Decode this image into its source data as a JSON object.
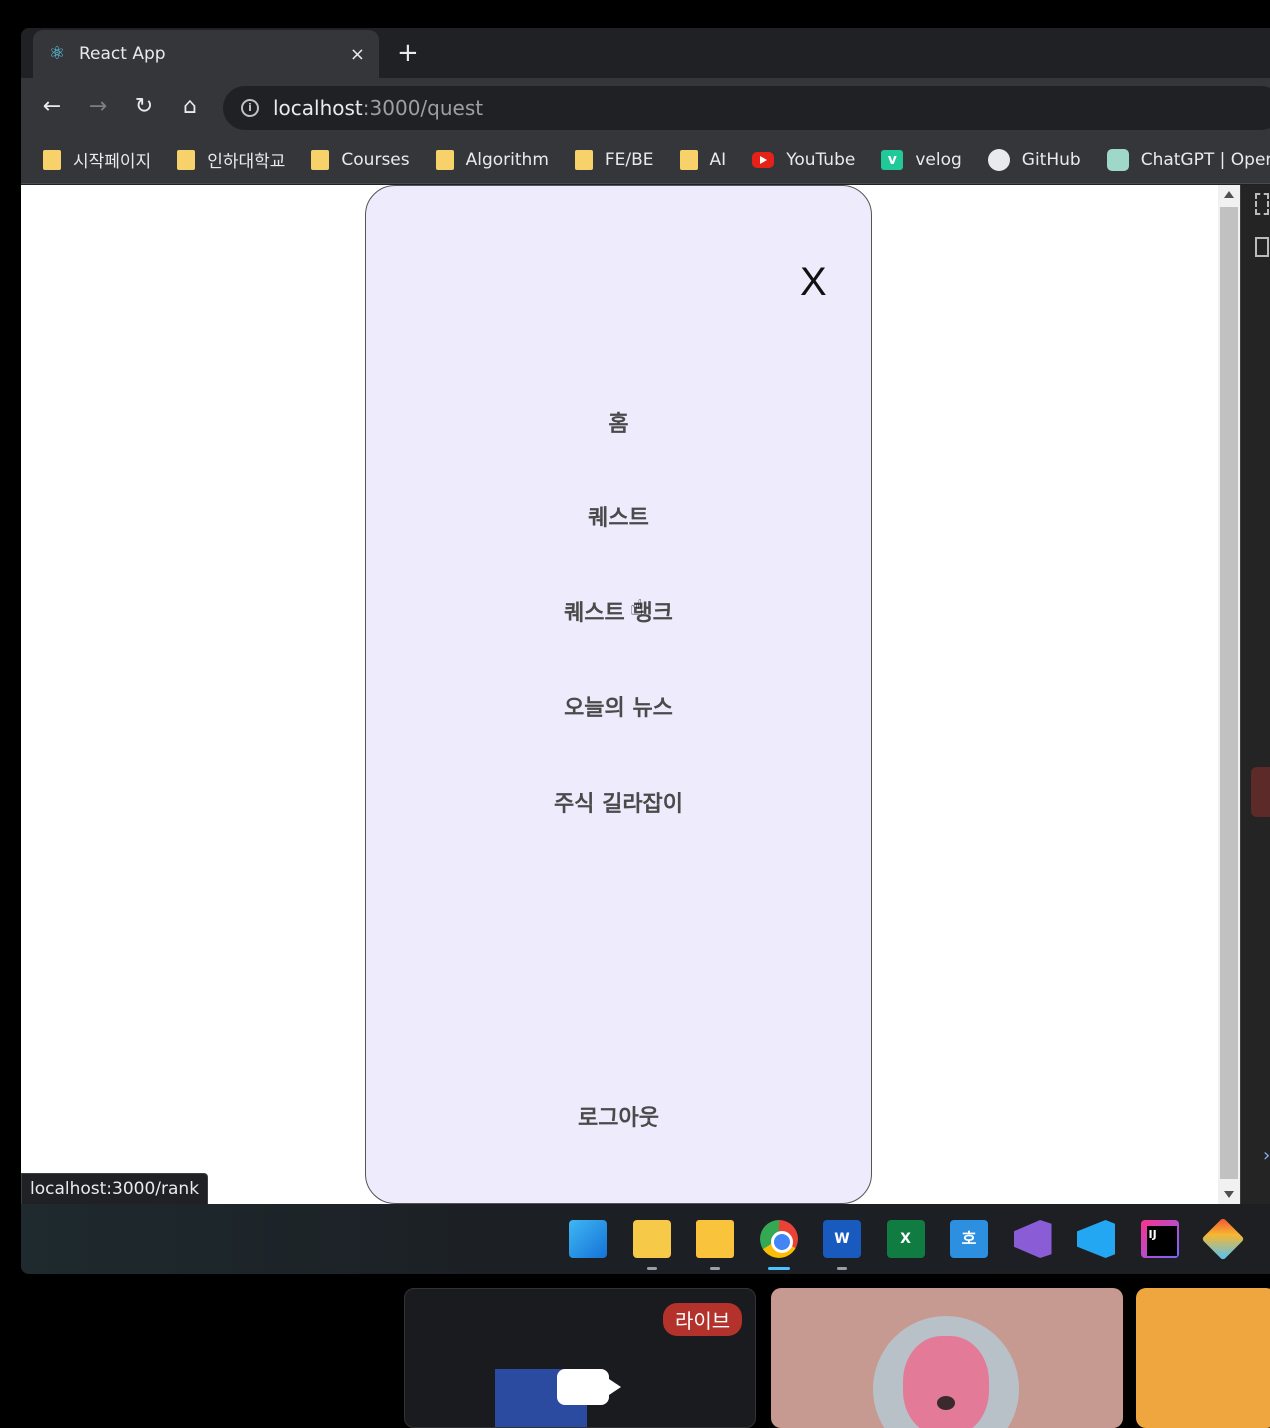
{
  "browser": {
    "tab_title": "React App",
    "tab_close": "×",
    "new_tab": "+",
    "url_host": "localhost",
    "url_path": ":3000/quest",
    "bookmarks": [
      {
        "label": "시작페이지",
        "icon": "folder-icon"
      },
      {
        "label": "인하대학교",
        "icon": "folder-icon"
      },
      {
        "label": "Courses",
        "icon": "folder-icon"
      },
      {
        "label": "Algorithm",
        "icon": "folder-icon"
      },
      {
        "label": "FE/BE",
        "icon": "folder-icon"
      },
      {
        "label": "AI",
        "icon": "folder-icon"
      },
      {
        "label": "YouTube",
        "icon": "youtube-icon"
      },
      {
        "label": "velog",
        "icon": "velog-icon"
      },
      {
        "label": "GitHub",
        "icon": "github-icon"
      },
      {
        "label": "ChatGPT | OpenA",
        "icon": "chatgpt-icon"
      }
    ],
    "status_url": "localhost:3000/rank"
  },
  "menu": {
    "close_label": "X",
    "items": [
      "홈",
      "퀘스트",
      "퀘스트 랭크",
      "오늘의 뉴스",
      "주식 길라잡이"
    ],
    "logout": "로그아웃"
  },
  "taskbar": {
    "apps": [
      "windows-start-icon",
      "sticky-notes-icon",
      "file-explorer-icon",
      "chrome-icon",
      "word-icon",
      "excel-icon",
      "hanword-icon",
      "visual-studio-icon",
      "vscode-icon",
      "intellij-icon",
      "git-icon"
    ],
    "word_letter": "W",
    "excel_letter": "X",
    "hanword_letter": "호"
  },
  "stream": {
    "live_badge": "라이브"
  }
}
